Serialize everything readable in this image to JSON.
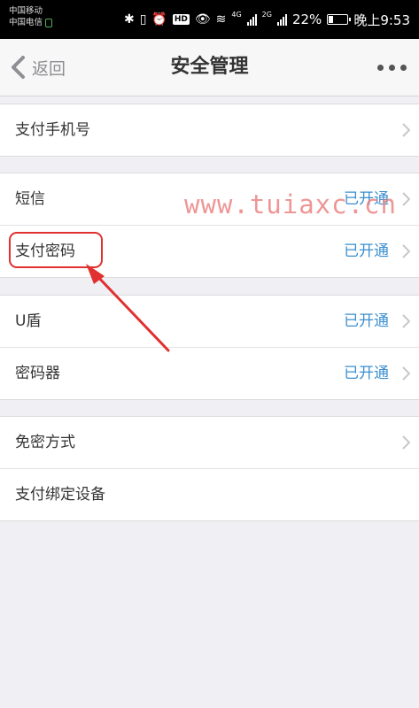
{
  "status_bar": {
    "carrier_1": "中国移动",
    "carrier_2": "中国电信",
    "hd": "HD",
    "net_1": "4G",
    "net_2": "2G",
    "battery": "22%",
    "time": "晚上9:53"
  },
  "nav": {
    "back_label": "返回",
    "title": "安全管理"
  },
  "groups": [
    {
      "rows": [
        {
          "label": "支付手机号",
          "status": ""
        }
      ]
    },
    {
      "rows": [
        {
          "label": "短信",
          "status": "已开通"
        },
        {
          "label": "支付密码",
          "status": "已开通"
        }
      ]
    },
    {
      "rows": [
        {
          "label": "U盾",
          "status": "已开通"
        },
        {
          "label": "密码器",
          "status": "已开通"
        }
      ]
    },
    {
      "rows": [
        {
          "label": "免密方式",
          "status": ""
        },
        {
          "label": "支付绑定设备",
          "status": ""
        }
      ]
    }
  ],
  "watermark": "www.tuiaxc.cn",
  "colors": {
    "status_blue": "#3b8fd0",
    "annotation_red": "#e03030",
    "background": "#efeff4"
  }
}
